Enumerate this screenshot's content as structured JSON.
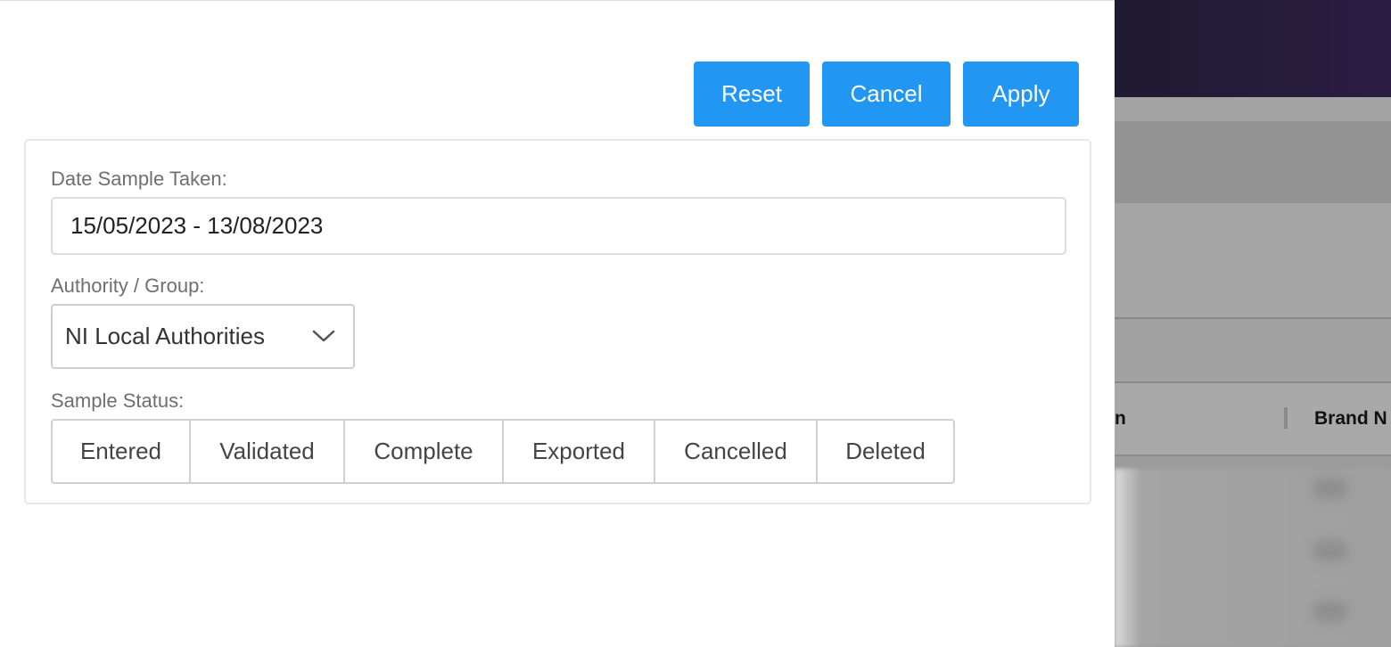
{
  "actions": {
    "reset_label": "Reset",
    "cancel_label": "Cancel",
    "apply_label": "Apply",
    "button_color": "#2196f3"
  },
  "filters": {
    "date_label": "Date Sample Taken:",
    "date_value": "15/05/2023 - 13/08/2023",
    "authority_label": "Authority / Group:",
    "authority_value": "NI Local Authorities",
    "status_label": "Sample Status:",
    "status_options": [
      "Entered",
      "Validated",
      "Complete",
      "Exported",
      "Cancelled",
      "Deleted"
    ]
  },
  "background": {
    "column_fragment": "n",
    "brand_column": "Brand N"
  }
}
